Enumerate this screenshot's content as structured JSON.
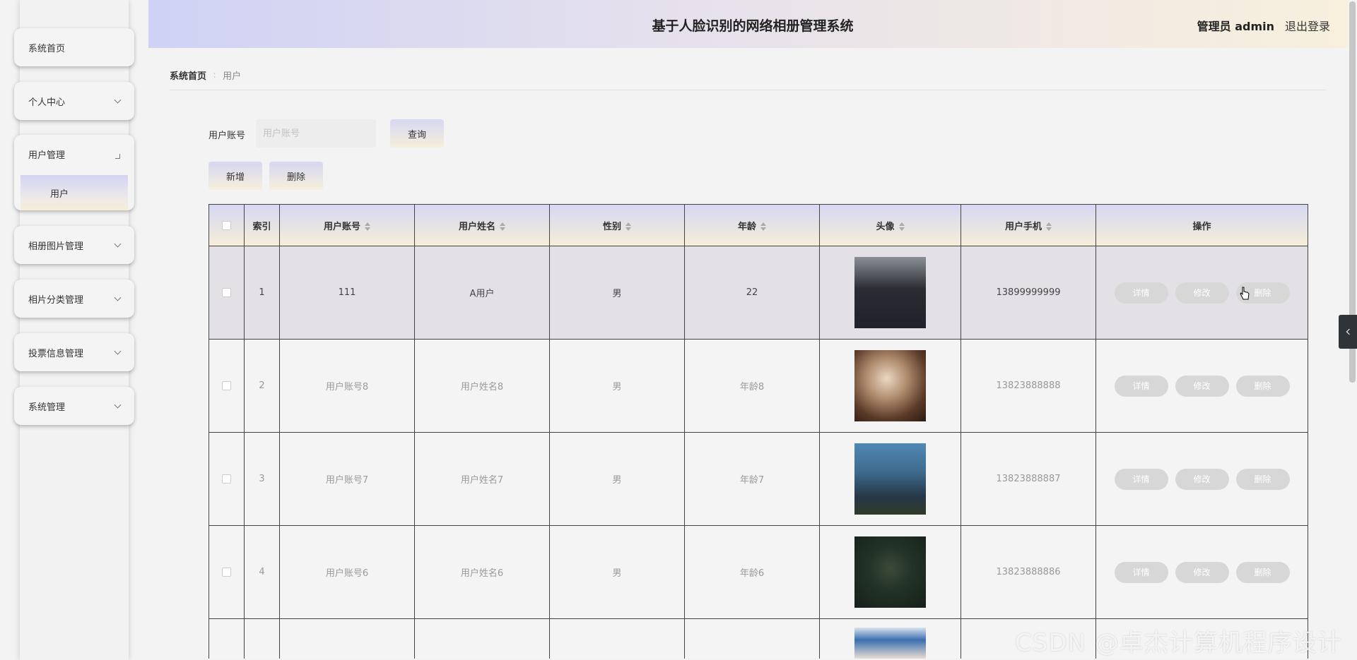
{
  "header": {
    "title": "基于人脸识别的网络相册管理系统",
    "user": "管理员 admin",
    "logout": "退出登录"
  },
  "sidebar": {
    "items": [
      {
        "label": "系统首页"
      },
      {
        "label": "个人中心"
      },
      {
        "label": "用户管理",
        "expanded": true,
        "children": [
          {
            "label": "用户"
          }
        ]
      },
      {
        "label": "相册图片管理"
      },
      {
        "label": "相片分类管理"
      },
      {
        "label": "投票信息管理"
      },
      {
        "label": "系统管理"
      }
    ]
  },
  "breadcrumb": {
    "home": "系统首页",
    "separator": "∶",
    "current": "用户"
  },
  "search": {
    "label": "用户账号",
    "placeholder": "用户账号",
    "query_button": "查询"
  },
  "toolbar": {
    "add": "新增",
    "delete": "删除"
  },
  "table": {
    "headers": {
      "index": "索引",
      "account": "用户账号",
      "name": "用户姓名",
      "gender": "性别",
      "age": "年龄",
      "avatar": "头像",
      "phone": "用户手机",
      "actions": "操作"
    },
    "rows": [
      {
        "index": "1",
        "account": "111",
        "name": "A用户",
        "gender": "男",
        "age": "22",
        "phone": "13899999999"
      },
      {
        "index": "2",
        "account": "用户账号8",
        "name": "用户姓名8",
        "gender": "男",
        "age": "年龄8",
        "phone": "13823888888"
      },
      {
        "index": "3",
        "account": "用户账号7",
        "name": "用户姓名7",
        "gender": "男",
        "age": "年龄7",
        "phone": "13823888887"
      },
      {
        "index": "4",
        "account": "用户账号6",
        "name": "用户姓名6",
        "gender": "男",
        "age": "年龄6",
        "phone": "13823888886"
      }
    ],
    "action_labels": {
      "detail": "详情",
      "edit": "修改",
      "delete": "删除"
    }
  },
  "watermark": "CSDN @卓杰计算机程序设计",
  "colors": {
    "header_gradient_start": "#cfd2f4",
    "header_gradient_end": "#f8f0dc",
    "action_pill": "#d7d7d7"
  }
}
